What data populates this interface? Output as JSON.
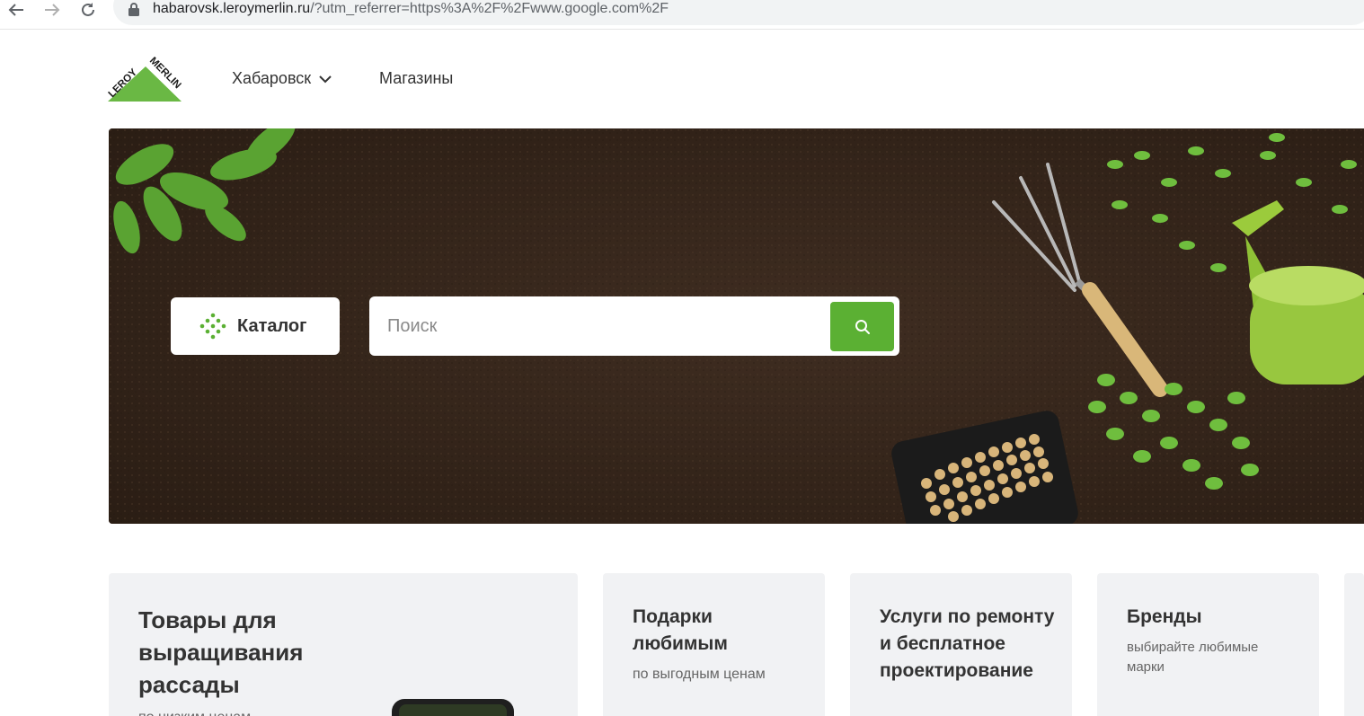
{
  "browser": {
    "url_domain": "habarovsk.leroymerlin.ru",
    "url_rest": "/?utm_referrer=https%3A%2F%2Fwww.google.com%2F"
  },
  "header": {
    "city": "Хабаровск",
    "stores": "Магазины"
  },
  "hero": {
    "catalog_label": "Каталог",
    "search_placeholder": "Поиск"
  },
  "cards": [
    {
      "title": "Товары для выращивания рассады",
      "subtitle": "по низким ценам"
    },
    {
      "title": "Подарки любимым",
      "subtitle": "по выгодным ценам"
    },
    {
      "title": "Услуги по ремонту и бесплатное проектирование",
      "subtitle": ""
    },
    {
      "title": "Бренды",
      "subtitle": "выбирайте любимые марки"
    }
  ],
  "colors": {
    "brand_green": "#5bb033",
    "card_bg": "#f1f2f4",
    "soil": "#3a2a1f"
  }
}
